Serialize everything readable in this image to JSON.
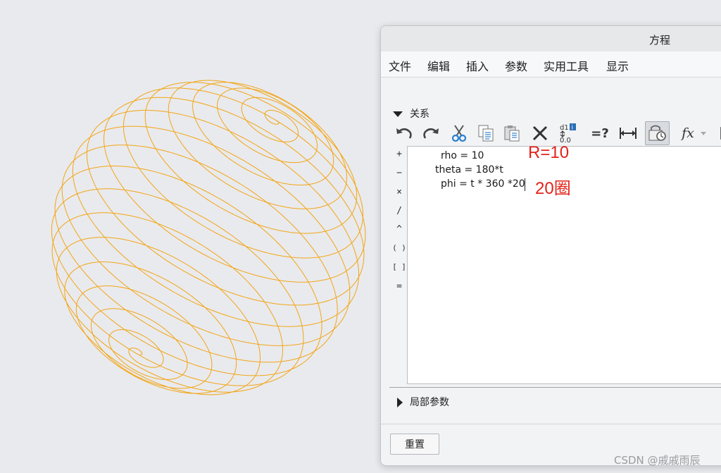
{
  "dialog": {
    "title": "方程",
    "menu": [
      "文件",
      "编辑",
      "插入",
      "参数",
      "实用工具",
      "显示"
    ],
    "relations_header": "关系",
    "local_params_header": "局部参数",
    "reset_label": "重置"
  },
  "toolbar": {
    "icons": [
      "undo-icon",
      "redo-icon",
      "cut-icon",
      "copy-icon",
      "paste-icon",
      "delete-icon",
      "verify-relations-icon",
      "evaluate-icon",
      "measure-icon",
      "lock-units-icon",
      "function-icon"
    ],
    "verify_label": "d1",
    "verify_value": "0.0",
    "evaluate_label": "=?",
    "function_label": "fx"
  },
  "operators": [
    "+",
    "−",
    "×",
    "/",
    "^",
    "( )",
    "[ ]",
    "="
  ],
  "equations": [
    "rho = 10",
    "theta = 180*t",
    "phi = t * 360 *20"
  ],
  "annotations": {
    "radius": "R=10",
    "turns": "20圈"
  },
  "watermark": "CSDN @戚戚雨辰",
  "colors": {
    "curve": "#f2a516",
    "annotation": "#e3231b",
    "background": "#e9eaed"
  }
}
